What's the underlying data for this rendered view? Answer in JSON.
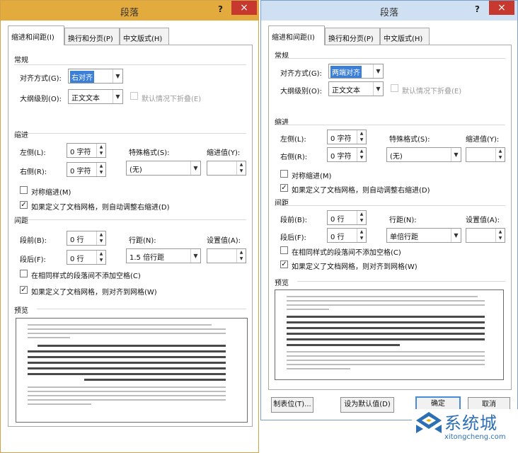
{
  "colors": {
    "title_left": "#e3aa3e",
    "title_right": "#cfe0f2",
    "close": "#c7392f",
    "selection": "#3c7fd7",
    "default_border": "#4a8bd8",
    "watermark": "#2d6fb4"
  },
  "left": {
    "title": "段落",
    "help": "?",
    "close": "×",
    "tabs": [
      "缩进和间距(I)",
      "换行和分页(P)",
      "中文版式(H)"
    ],
    "general": "常规",
    "align_label": "对齐方式(G):",
    "align_value": "右对齐",
    "outline_label": "大纲级别(O):",
    "outline_value": "正文文本",
    "collapse_label": "默认情况下折叠(E)",
    "indent": "缩进",
    "left_label": "左侧(L):",
    "left_value": "0 字符",
    "right_label": "右侧(R):",
    "right_value": "0 字符",
    "special_label": "特殊格式(S):",
    "special_value": "(无)",
    "indentval_label": "缩进值(Y):",
    "mirror_label": "对称缩进(M)",
    "autoindent_label": "如果定义了文档网格，则自动调整右缩进(D)",
    "spacing": "间距",
    "before_label": "段前(B):",
    "before_value": "0 行",
    "after_label": "段后(F):",
    "after_value": "0 行",
    "linespacing_label": "行距(N):",
    "linespacing_value": "1.5 倍行距",
    "setval_label": "设置值(A):",
    "nospace_label": "在相同样式的段落间不添加空格(C)",
    "snap_label": "如果定义了文档网格，则对齐到网格(W)",
    "preview": "预览"
  },
  "right": {
    "title": "段落",
    "help": "?",
    "close": "×",
    "tabs": [
      "缩进和间距(I)",
      "换行和分页(P)",
      "中文版式(H)"
    ],
    "general": "常规",
    "align_label": "对齐方式(G):",
    "align_value": "两端对齐",
    "outline_label": "大纲级别(O):",
    "outline_value": "正文文本",
    "collapse_label": "默认情况下折叠(E)",
    "indent": "缩进",
    "left_label": "左侧(L):",
    "left_value": "0 字符",
    "right_label": "右侧(R):",
    "right_value": "0 字符",
    "special_label": "特殊格式(S):",
    "special_value": "(无)",
    "indentval_label": "缩进值(Y):",
    "mirror_label": "对称缩进(M)",
    "autoindent_label": "如果定义了文档网格，则自动调整右缩进(D)",
    "spacing": "间距",
    "before_label": "段前(B):",
    "before_value": "0 行",
    "after_label": "段后(F):",
    "after_value": "0 行",
    "linespacing_label": "行距(N):",
    "linespacing_value": "单倍行距",
    "setval_label": "设置值(A):",
    "nospace_label": "在相同样式的段落间不添加空格(C)",
    "snap_label": "如果定义了文档网格，则对齐到网格(W)",
    "preview": "预览",
    "btn_tabs": "制表位(T)...",
    "btn_default": "设为默认值(D)",
    "btn_ok": "确定",
    "btn_cancel": "取消"
  },
  "watermark": {
    "cn": "系统城",
    "en": "xitongcheng.com",
    "icon": "xitongcheng-logo-icon"
  }
}
